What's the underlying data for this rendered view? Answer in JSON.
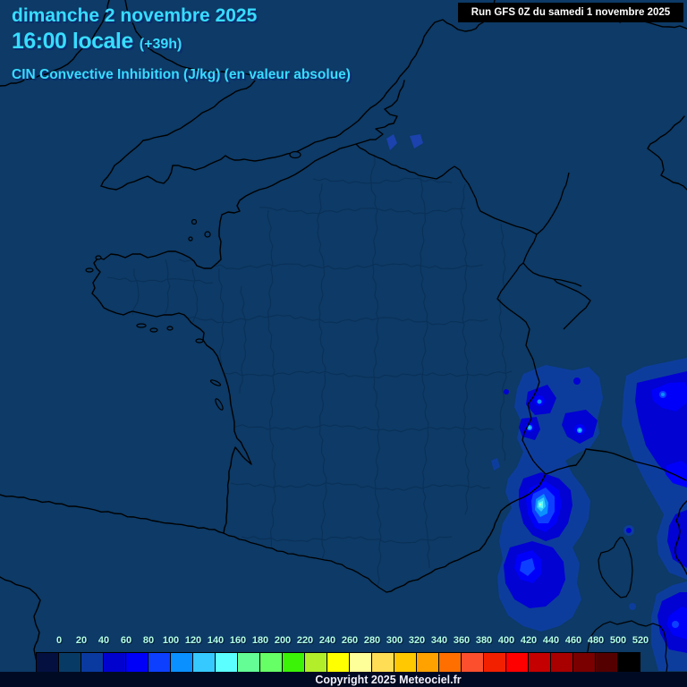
{
  "header": {
    "date": "dimanche 2 novembre 2025",
    "time": "16:00 locale",
    "offset": "(+39h)",
    "subtitle": "CIN Convective Inhibition (J/kg) (en valeur absolue)",
    "run": "Run GFS 0Z du samedi 1 novembre 2025"
  },
  "footer": {
    "copyright": "Copyright 2025 Meteociel.fr"
  },
  "scale": {
    "unit": "J/kg",
    "labels": [
      "0",
      "20",
      "40",
      "60",
      "80",
      "100",
      "120",
      "140",
      "160",
      "180",
      "200",
      "220",
      "240",
      "260",
      "280",
      "300",
      "320",
      "340",
      "360",
      "380",
      "400",
      "420",
      "440",
      "460",
      "480",
      "500",
      "520"
    ],
    "colors": [
      "#041040",
      "#083a66",
      "#0a3aa0",
      "#0202cf",
      "#0000f8",
      "#0d3fff",
      "#0a90ff",
      "#36c9ff",
      "#5bffff",
      "#63fc95",
      "#66ff66",
      "#3bf307",
      "#b2ef2a",
      "#ffff00",
      "#ffff99",
      "#ffdd55",
      "#ffc800",
      "#ffa200",
      "#ff6f00",
      "#fb4f2e",
      "#f32000",
      "#ff0000",
      "#c40000",
      "#a80000",
      "#7a0000",
      "#550000",
      "#000000"
    ]
  },
  "colors": {
    "title_text": "#38dcff",
    "scale_label_text": "#b4ffe4",
    "map_background": "#0d3a66",
    "department_border": "#0a3057",
    "coast_border": "#000000",
    "run_box_bg": "#000000",
    "run_box_text": "#ffffff",
    "footer_bg": "#000b23",
    "footer_text": "#f2f2ff",
    "cin_levels": [
      "#0d3d9c",
      "#0202d2",
      "#0000fa",
      "#0d3fff",
      "#0a90ff",
      "#36c9ff",
      "#5bffff",
      "#b0ffcf"
    ]
  }
}
